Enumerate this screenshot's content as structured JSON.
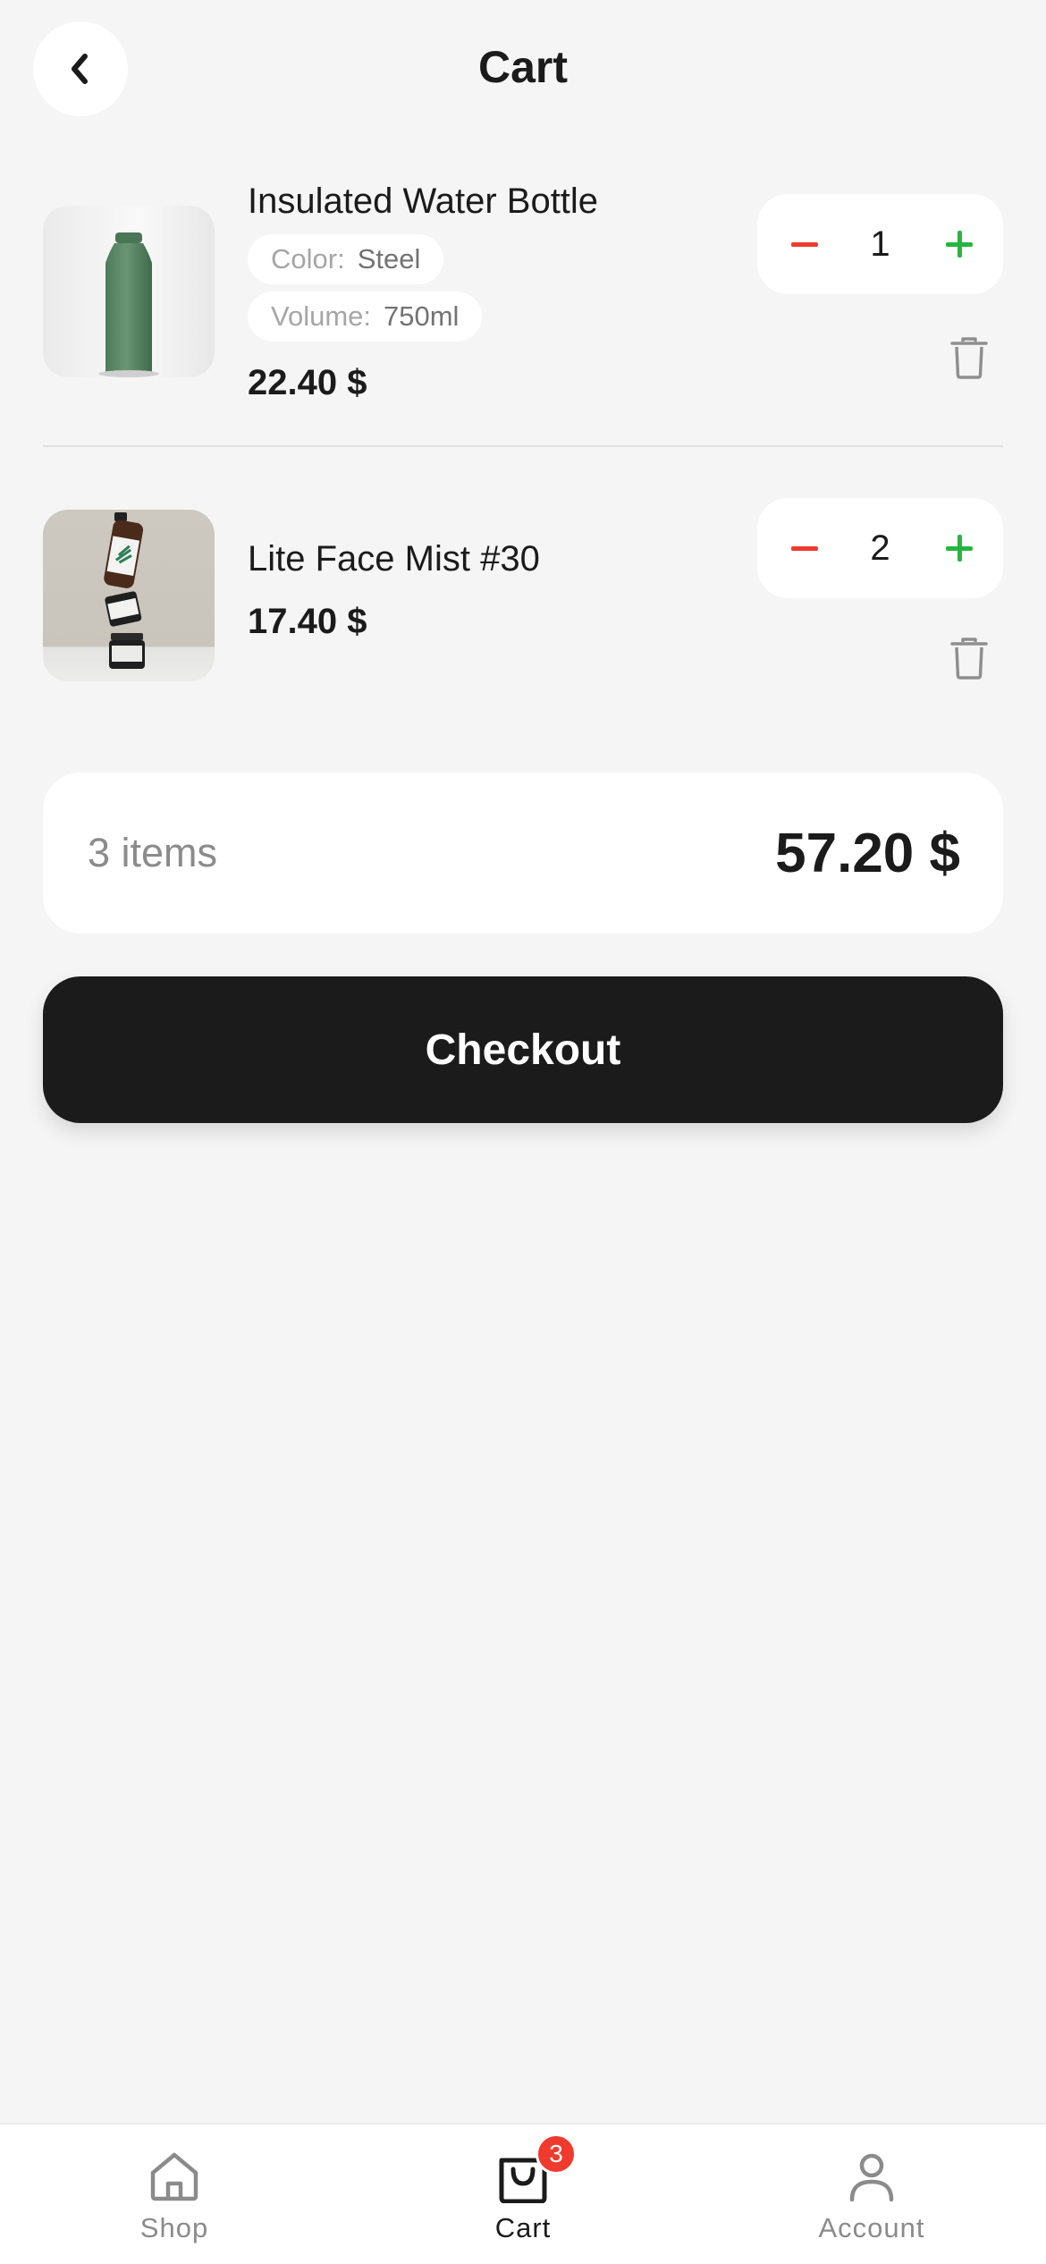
{
  "header": {
    "title": "Cart",
    "back_icon": "chevron-left-icon"
  },
  "items": [
    {
      "name": "Insulated Water Bottle",
      "image": "green-water-bottle-photo",
      "options": [
        {
          "label": "Color:",
          "value": "Steel"
        },
        {
          "label": "Volume:",
          "value": "750ml"
        }
      ],
      "price": "22.40 $",
      "quantity": "1"
    },
    {
      "name": "Lite Face Mist #30",
      "image": "stacked-skincare-bottles-photo",
      "options": [],
      "price": "17.40 $",
      "quantity": "2"
    }
  ],
  "stepper_icons": {
    "minus": "minus-icon",
    "plus": "plus-icon",
    "remove": "trash-icon"
  },
  "summary": {
    "count": "3 items",
    "total": "57.20 $"
  },
  "checkout": {
    "label": "Checkout"
  },
  "tabbar": {
    "tabs": [
      {
        "label": "Shop",
        "icon": "home-icon",
        "active": false
      },
      {
        "label": "Cart",
        "icon": "shopping-bag-icon",
        "active": true,
        "badge": "3"
      },
      {
        "label": "Account",
        "icon": "user-icon",
        "active": false
      }
    ]
  },
  "colors": {
    "background": "#f5f5f5",
    "card": "#ffffff",
    "primary_text": "#1b1b1b",
    "minus": "#f03a2e",
    "plus": "#27b541",
    "badge": "#f03a2e",
    "checkout_bg": "#1b1b1b"
  }
}
